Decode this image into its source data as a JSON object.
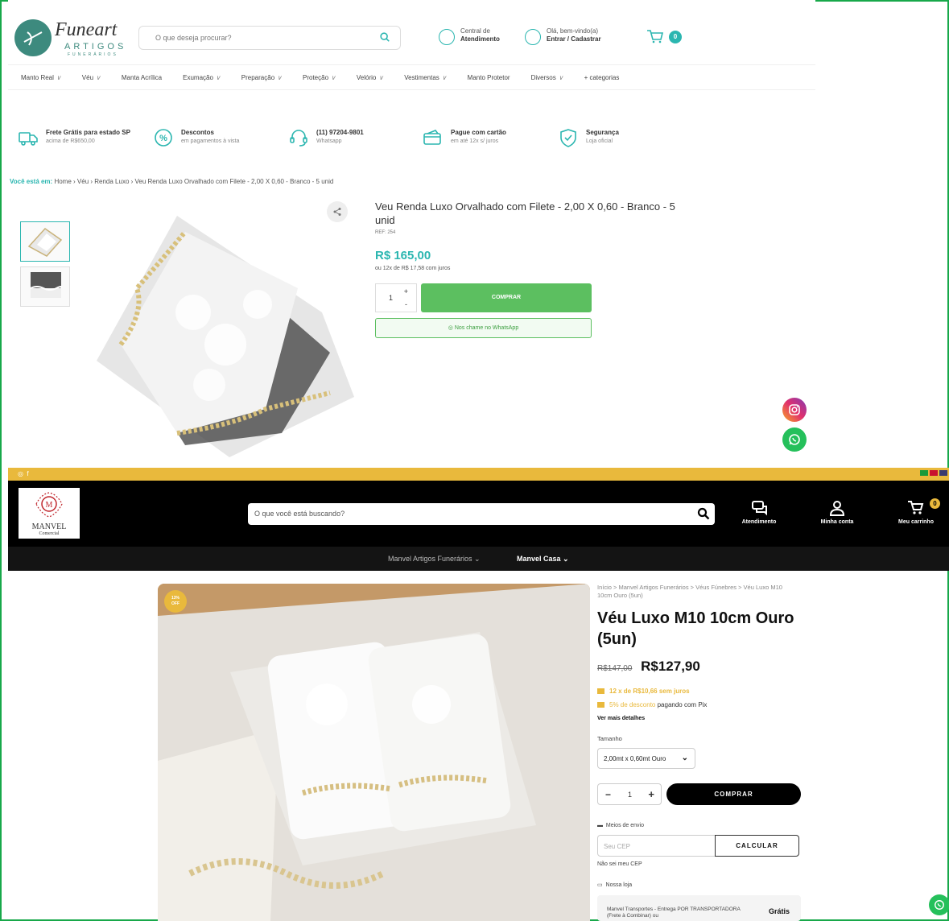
{
  "site1": {
    "logo": {
      "name": "Funeart",
      "sub1": "ARTIGOS",
      "sub2": "FUNERÁRIOS"
    },
    "search_placeholder": "O que deseja procurar?",
    "support": {
      "line1": "Central de",
      "line2": "Atendimento"
    },
    "account": {
      "line1": "Olá, bem-vindo(a)",
      "line2": "Entrar / Cadastrar"
    },
    "cart_count": "0",
    "nav": [
      "Manto Real",
      "Véu",
      "Manta Acrílica",
      "Exumação",
      "Preparação",
      "Proteção",
      "Velório",
      "Vestimentas",
      "Manto Protetor",
      "Diversos",
      "+ categorias"
    ],
    "benefits": [
      {
        "title": "Frete Grátis para estado SP",
        "sub": "acima de R$650,00",
        "icon": "truck-icon"
      },
      {
        "title": "Descontos",
        "sub": "em pagamentos à vista",
        "icon": "percent-icon"
      },
      {
        "title": "(11) 97204-9801",
        "sub": "Whatsapp",
        "icon": "headset-icon"
      },
      {
        "title": "Pague com cartão",
        "sub": "em até 12x s/ juros",
        "icon": "card-icon"
      },
      {
        "title": "Segurança",
        "sub": "Loja oficial",
        "icon": "shield-icon"
      }
    ],
    "breadcrumb": {
      "lead": "Você está em:",
      "items": [
        "Home",
        "Véu",
        "Renda Luxo",
        "Veu Renda Luxo Orvalhado com Filete - 2,00 X 0,60 - Branco - 5 unid"
      ]
    },
    "product": {
      "title": "Veu Renda Luxo Orvalhado com Filete - 2,00 X 0,60 - Branco - 5 unid",
      "ref": "REF: 254",
      "price": "R$ 165,00",
      "installments": "ou 12x de R$ 17,58 com juros",
      "qty": "1",
      "buy_label": "COMPRAR",
      "whatsapp_label": "Nos chame no WhatsApp"
    }
  },
  "site2": {
    "logo": {
      "name": "MANVEL",
      "sub": "Comercial"
    },
    "search_placeholder": "O que você está buscando?",
    "header_links": [
      "Atendimento",
      "Minha conta",
      "Meu carrinho"
    ],
    "cart_count": "0",
    "nav": [
      "Manvel Artigos Funerários",
      "Manvel Casa"
    ],
    "badge": {
      "line1": "13%",
      "line2": "OFF"
    },
    "breadcrumb": "Início > Manvel Artigos Funerários > Véus Fúnebres > Véu Luxo M10 10cm Ouro (5un)",
    "product": {
      "title": "Véu Luxo M10 10cm Ouro (5un)",
      "old_price": "R$147,00",
      "price": "R$127,90",
      "installments": "12 x de R$10,66 sem juros",
      "pix_highlight": "5% de desconto",
      "pix_rest": "pagando com Pix",
      "more_details": "Ver mais detalhes",
      "size_label": "Tamanho",
      "size_value": "2,00mt x 0,60mt Ouro",
      "qty": "1",
      "buy_label": "COMPRAR",
      "shipping_label": "Meios de envio",
      "cep_placeholder": "Seu CEP",
      "calc_label": "CALCULAR",
      "no_cep": "Não sei meu CEP",
      "store_label": "Nossa loja",
      "shipping_option": "Manvel Transportes - Entrega POR TRANSPORTADORA (Frete à Combinar) ou",
      "shipping_price": "Grátis"
    }
  },
  "colors": {
    "teal": "#2bb6b0",
    "green": "#5cbf60",
    "gold": "#e9b93c",
    "frame": "#18a84a"
  }
}
